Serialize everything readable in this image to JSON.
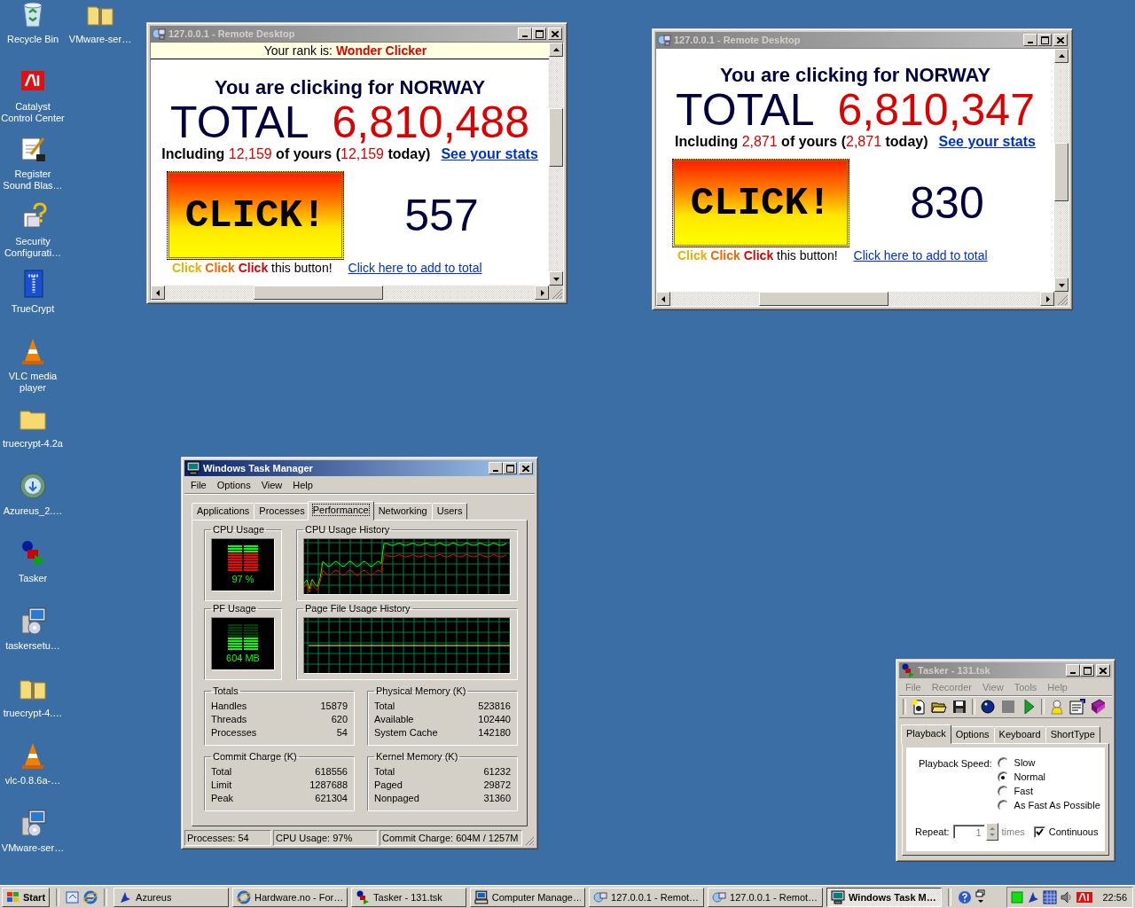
{
  "desktop_icons": [
    {
      "label": "Recycle Bin"
    },
    {
      "label": "VMware-ser…"
    },
    {
      "label": "Catalyst Control Center"
    },
    {
      "label": "Register Sound Blas…"
    },
    {
      "label": "Security Configurati…"
    },
    {
      "label": "TrueCrypt"
    },
    {
      "label": "VLC media player"
    },
    {
      "label": "truecrypt-4.2a"
    },
    {
      "label": "Azureus_2.…"
    },
    {
      "label": "Tasker"
    },
    {
      "label": "taskersetu…"
    },
    {
      "label": "truecrypt-4.…"
    },
    {
      "label": "vlc-0.8.6a-…"
    },
    {
      "label": "VMware-ser…"
    }
  ],
  "remote_windows": [
    {
      "title": "127.0.0.1 - Remote Desktop",
      "active": false,
      "rank": {
        "label": "Your rank is:",
        "value": "Wonder Clicker"
      },
      "heading": "You are clicking for NORWAY",
      "total_label": "TOTAL",
      "total_value": "6,810,488",
      "including": {
        "prefix": "Including",
        "yours": "12,159",
        "middle": "of yours (",
        "today": "12,159",
        "suffix": "today)"
      },
      "stats_link": "See your stats",
      "click_button": "CLICK!",
      "counter": "557",
      "caption": {
        "words": [
          "Click",
          "Click",
          "Click"
        ],
        "rest": "this button!"
      },
      "add_link": "Click here to add to total"
    },
    {
      "title": "127.0.0.1 - Remote Desktop",
      "active": false,
      "heading": "You are clicking for NORWAY",
      "total_label": "TOTAL",
      "total_value": "6,810,347",
      "including": {
        "prefix": "Including",
        "yours": "2,871",
        "middle": "of yours (",
        "today": "2,871",
        "suffix": "today)"
      },
      "stats_link": "See your stats",
      "click_button": "CLICK!",
      "counter": "830",
      "caption": {
        "words": [
          "Click",
          "Click",
          "Click"
        ],
        "rest": "this button!"
      },
      "add_link": "Click here to add to total"
    }
  ],
  "task_manager": {
    "title": "Windows Task Manager",
    "active": true,
    "menu": [
      "File",
      "Options",
      "View",
      "Help"
    ],
    "tabs": [
      {
        "label": "Applications",
        "selected": false
      },
      {
        "label": "Processes",
        "selected": false
      },
      {
        "label": "Performance",
        "selected": true
      },
      {
        "label": "Networking",
        "selected": false
      },
      {
        "label": "Users",
        "selected": false
      }
    ],
    "cpu_usage": {
      "title": "CPU Usage",
      "reading": "97 %",
      "level": 0.97
    },
    "cpu_history": {
      "title": "CPU Usage History"
    },
    "pf_usage": {
      "title": "PF Usage",
      "reading": "604 MB",
      "level": 0.48
    },
    "pf_history": {
      "title": "Page File Usage History"
    },
    "groups": [
      {
        "title": "Totals",
        "rows": [
          {
            "label": "Handles",
            "value": "15879"
          },
          {
            "label": "Threads",
            "value": "620"
          },
          {
            "label": "Processes",
            "value": "54"
          }
        ]
      },
      {
        "title": "Physical Memory (K)",
        "rows": [
          {
            "label": "Total",
            "value": "523816"
          },
          {
            "label": "Available",
            "value": "102440"
          },
          {
            "label": "System Cache",
            "value": "142180"
          }
        ]
      },
      {
        "title": "Commit Charge (K)",
        "rows": [
          {
            "label": "Total",
            "value": "618556"
          },
          {
            "label": "Limit",
            "value": "1287688"
          },
          {
            "label": "Peak",
            "value": "621304"
          }
        ]
      },
      {
        "title": "Kernel Memory (K)",
        "rows": [
          {
            "label": "Total",
            "value": "61232"
          },
          {
            "label": "Paged",
            "value": "29872"
          },
          {
            "label": "Nonpaged",
            "value": "31360"
          }
        ]
      }
    ],
    "status_bar": [
      "Processes: 54",
      "CPU Usage: 97%",
      "Commit Charge: 604M / 1257M"
    ]
  },
  "tasker": {
    "title": "Tasker - 131.tsk",
    "active": false,
    "menu": [
      "File",
      "Recorder",
      "View",
      "Tools",
      "Help"
    ],
    "tabs": [
      {
        "label": "Playback",
        "selected": true
      },
      {
        "label": "Options",
        "selected": false
      },
      {
        "label": "Keyboard",
        "selected": false
      },
      {
        "label": "ShortType",
        "selected": false
      }
    ],
    "speed_label": "Playback Speed:",
    "speeds": [
      {
        "label": "Slow",
        "selected": false
      },
      {
        "label": "Normal",
        "selected": true
      },
      {
        "label": "Fast",
        "selected": false
      },
      {
        "label": "As Fast As Possible",
        "selected": false
      }
    ],
    "repeat_label": "Repeat:",
    "repeat_value": "1",
    "times_label": "times",
    "continuous": {
      "label": "Continuous",
      "checked": true
    }
  },
  "taskbar": {
    "start": "Start",
    "tasks": [
      {
        "label": "Azureus",
        "selected": false
      },
      {
        "label": "Hardware.no - For…",
        "selected": false
      },
      {
        "label": "Tasker - 131.tsk",
        "selected": false
      },
      {
        "label": "Computer Manage…",
        "selected": false
      },
      {
        "label": "127.0.0.1 - Remot…",
        "selected": false
      },
      {
        "label": "127.0.0.1 - Remot…",
        "selected": false
      },
      {
        "label": "Windows Task M…",
        "selected": true
      }
    ],
    "clock": "22:56"
  }
}
